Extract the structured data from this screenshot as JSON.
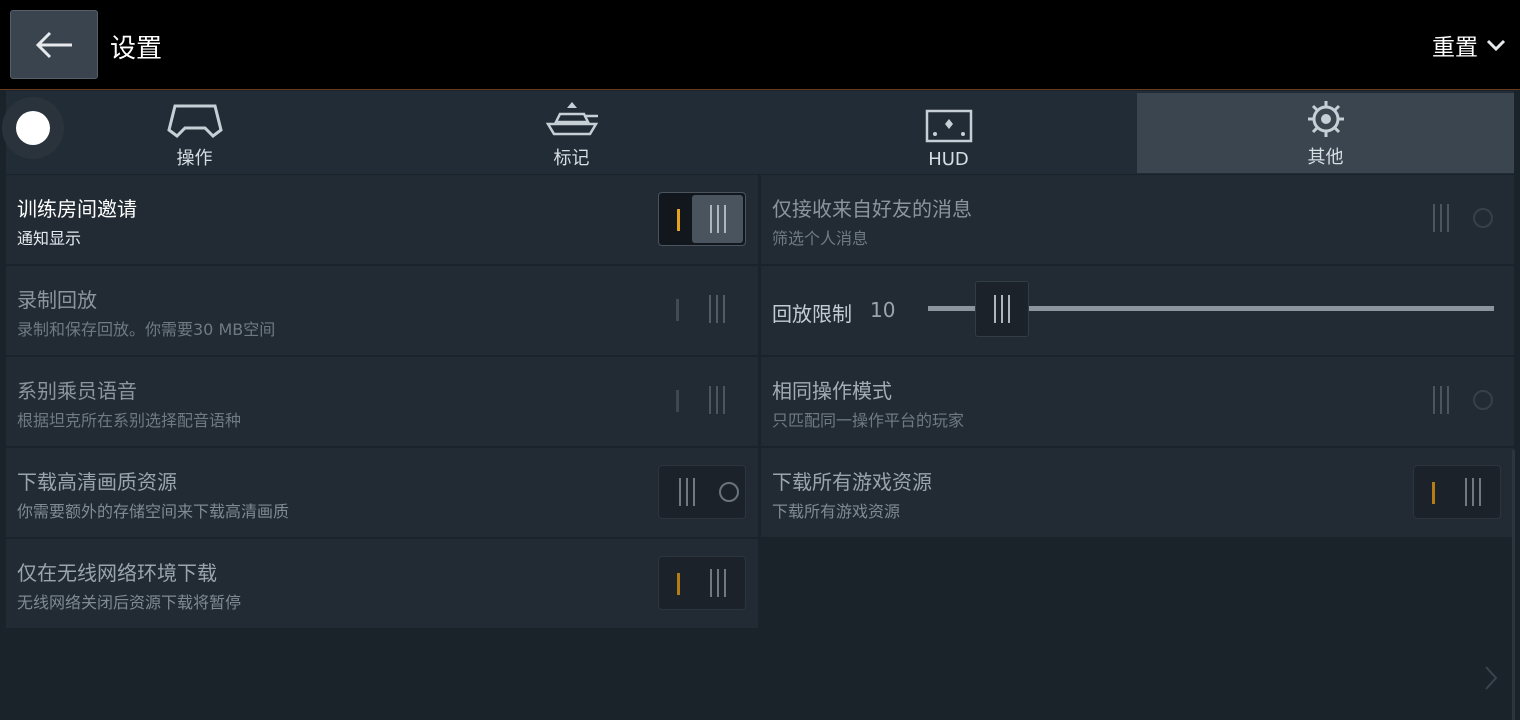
{
  "header": {
    "title": "设置",
    "reset_label": "重置"
  },
  "tabs": [
    {
      "label": "操作",
      "icon": "gamepad-icon"
    },
    {
      "label": "标记",
      "icon": "tank-marker-icon"
    },
    {
      "label": "HUD",
      "icon": "hud-screen-icon"
    },
    {
      "label": "其他",
      "icon": "gear-icon",
      "active": true
    }
  ],
  "settings": {
    "training_invite": {
      "label": "训练房间邀请",
      "desc": "通知显示",
      "state": "on"
    },
    "friends_only_msg": {
      "label": "仅接收来自好友的消息",
      "desc": "筛选个人消息",
      "state": "off"
    },
    "record_replay": {
      "label": "录制回放",
      "desc": "录制和保存回放。你需要30 MB空间",
      "state": "on"
    },
    "replay_limit": {
      "label": "回放限制",
      "value": "10"
    },
    "crew_voice": {
      "label": "系别乘员语音",
      "desc": "根据坦克所在系别选择配音语种",
      "state": "on"
    },
    "same_mode": {
      "label": "相同操作模式",
      "desc": "只匹配同一操作平台的玩家",
      "state": "off"
    },
    "hd_resources": {
      "label": "下载高清画质资源",
      "desc": "你需要额外的存储空间来下载高清画质",
      "state": "off"
    },
    "all_resources": {
      "label": "下载所有游戏资源",
      "desc": "下载所有游戏资源",
      "state": "on"
    },
    "wifi_only": {
      "label": "仅在无线网络环境下载",
      "desc": "无线网络关闭后资源下载将暂停",
      "state": "on"
    }
  },
  "colors": {
    "accent_on": "#e8a21c",
    "background": "#1a222a",
    "row": "#222b34"
  }
}
